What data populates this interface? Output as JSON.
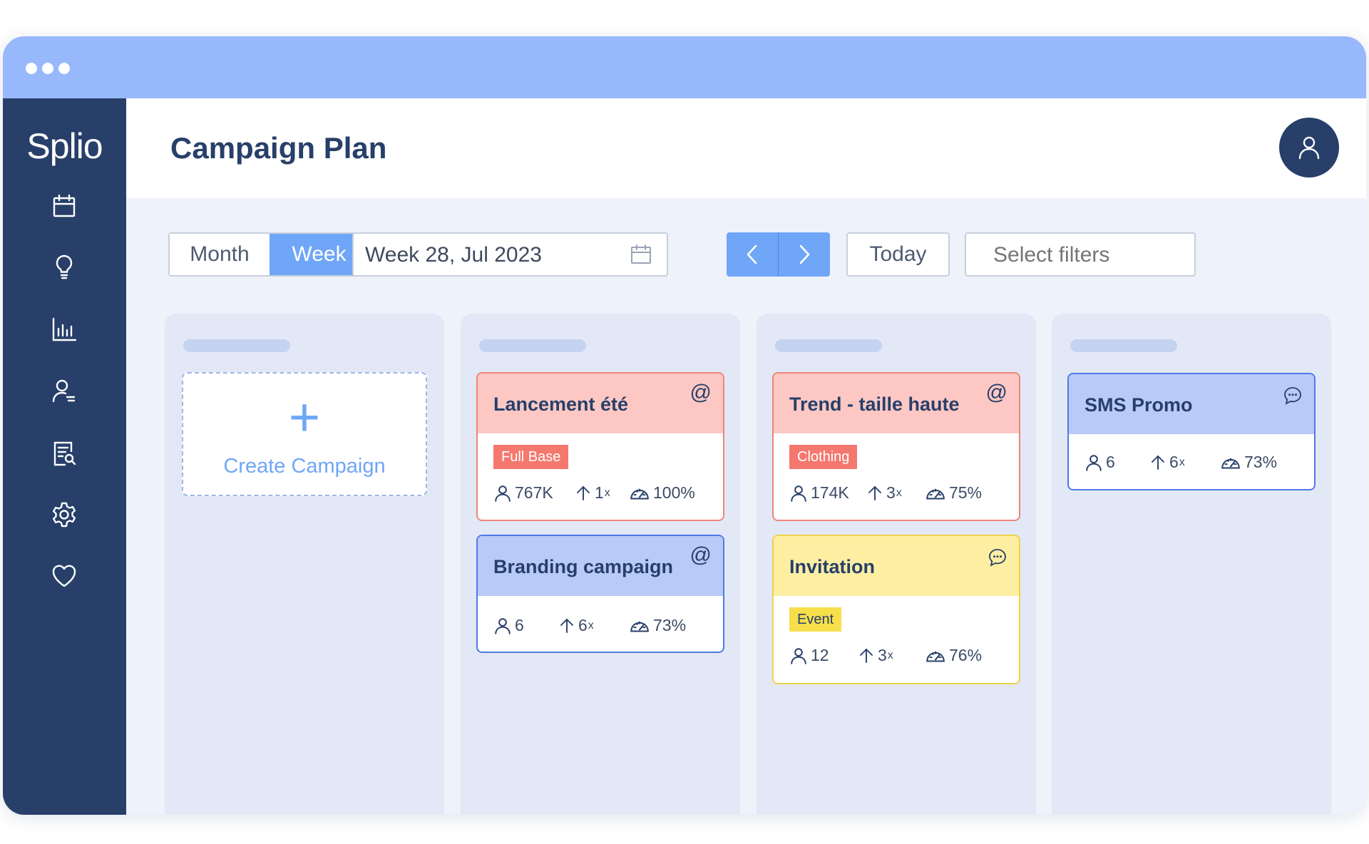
{
  "window": {
    "dots": 3
  },
  "colors": {
    "titlebar": "#98b8fc",
    "sidebar": "#273f69",
    "accent": "#6fa6f7",
    "email_card_bg": "#fdc8c4",
    "email_card_border": "#f0837a",
    "blue_card_bg": "#b9caf9",
    "blue_card_border": "#4d7ae6",
    "yellow_card_bg": "#fdeea2",
    "yellow_card_border": "#f0d24a"
  },
  "sidebar": {
    "logo": "Splio",
    "items": [
      {
        "icon": "calendar-icon"
      },
      {
        "icon": "lightbulb-icon"
      },
      {
        "icon": "bar-chart-icon"
      },
      {
        "icon": "user-settings-icon"
      },
      {
        "icon": "document-search-icon"
      },
      {
        "icon": "gear-icon"
      },
      {
        "icon": "heart-icon"
      }
    ]
  },
  "header": {
    "title": "Campaign Plan",
    "avatar_icon": "user-icon"
  },
  "toolbar": {
    "view_month": "Month",
    "view_week": "Week",
    "date_value": "Week 28, Jul 2023",
    "today": "Today",
    "filters_placeholder": "Select filters"
  },
  "create": {
    "label": "Create Campaign",
    "plus": "+"
  },
  "cards": {
    "lancement": {
      "title": "Lancement été",
      "channel": "@",
      "tag": "Full Base",
      "audience": "767K",
      "sends": "1",
      "sends_unit": "x",
      "perf": "100%"
    },
    "branding": {
      "title": "Branding campaign",
      "channel": "@",
      "audience": "6",
      "sends": "6",
      "sends_unit": "x",
      "perf": "73%"
    },
    "trend": {
      "title": "Trend - taille haute",
      "channel": "@",
      "tag": "Clothing",
      "audience": "174K",
      "sends": "3",
      "sends_unit": "x",
      "perf": "75%"
    },
    "invitation": {
      "title": "Invitation",
      "channel_icon": "chat-bubble-icon",
      "tag": "Event",
      "audience": "12",
      "sends": "3",
      "sends_unit": "x",
      "perf": "76%"
    },
    "sms": {
      "title": "SMS Promo",
      "channel_icon": "chat-bubble-icon",
      "audience": "6",
      "sends": "6",
      "sends_unit": "x",
      "perf": "73%"
    }
  }
}
